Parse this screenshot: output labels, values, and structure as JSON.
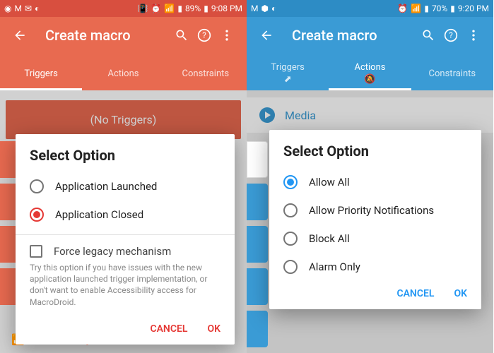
{
  "left": {
    "status": {
      "battery": "89%",
      "time": "9:08 PM"
    },
    "appbar": {
      "title": "Create macro"
    },
    "tabs": {
      "t1": "Triggers",
      "t2": "Actions",
      "t3": "Constraints"
    },
    "no_triggers": "(No Triggers)",
    "dialog": {
      "title": "Select Option",
      "opt1": "Application Launched",
      "opt2": "Application Closed",
      "check": "Force legacy mechanism",
      "hint": "Try this option if you have issues with the new application launched trigger implementation, or don't want to enable Accessibility access for MacroDroid.",
      "cancel": "CANCEL",
      "ok": "OK"
    },
    "connectivity": "Connectivity"
  },
  "right": {
    "status": {
      "battery": "70%",
      "time": "9:20 PM"
    },
    "appbar": {
      "title": "Create macro"
    },
    "tabs": {
      "t1": "Triggers",
      "t2": "Actions",
      "t3": "Constraints"
    },
    "media": "Media",
    "dialog": {
      "title": "Select Option",
      "opt1": "Allow All",
      "opt2": "Allow Priority Notifications",
      "opt3": "Block All",
      "opt4": "Alarm Only",
      "cancel": "CANCEL",
      "ok": "OK"
    }
  }
}
